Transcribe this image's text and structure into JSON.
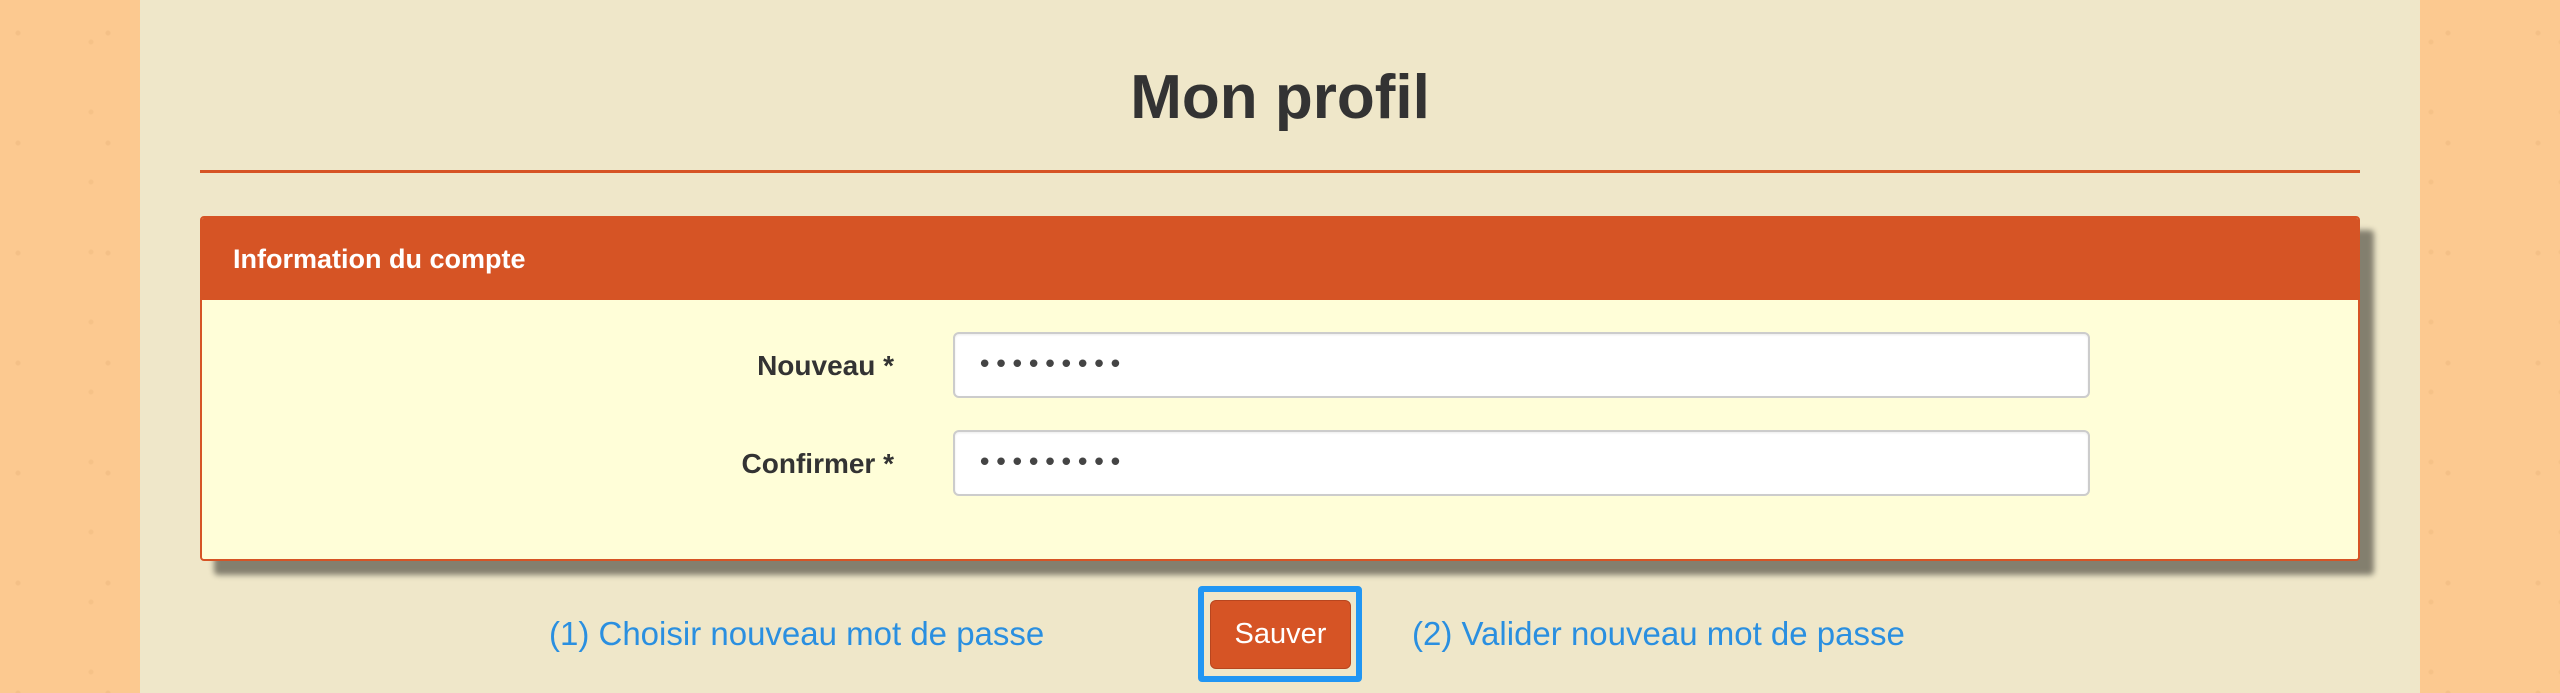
{
  "page": {
    "title": "Mon profil"
  },
  "account_card": {
    "header": "Information du compte",
    "fields": [
      {
        "label": "Nouveau *",
        "value": "•••••••••",
        "type": "password"
      },
      {
        "label": "Confirmer *",
        "value": "•••••••••",
        "type": "password"
      }
    ]
  },
  "actions": {
    "save_label": "Sauver",
    "hint_step1": "(1) Choisir nouveau mot de passe",
    "hint_step2": "(2) Valider nouveau mot de passe"
  },
  "colors": {
    "accent": "#d65425",
    "panel_bg": "#efe7c9",
    "card_bg": "#fffed8",
    "hint_blue": "#2a8fe0",
    "focus_ring": "#2196f3"
  }
}
